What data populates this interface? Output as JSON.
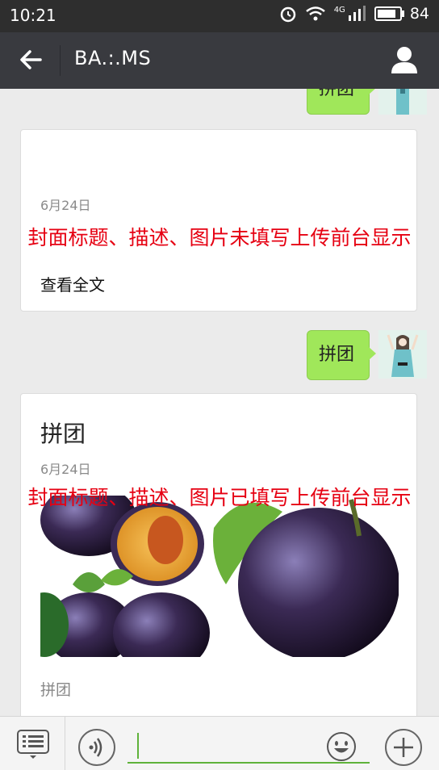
{
  "status": {
    "time": "10:21",
    "network": "4G",
    "battery": "84",
    "battery_level": 0.84
  },
  "header": {
    "title": "BA.:.MS"
  },
  "messages": [
    {
      "type": "sent",
      "text": "拼团"
    },
    {
      "type": "card",
      "date": "6月24日",
      "overlay": "封面标题、描述、图片未填写上传前台显示",
      "read_all": "查看全文"
    },
    {
      "type": "sent",
      "text": "拼团"
    },
    {
      "type": "card",
      "title": "拼团",
      "date": "6月24日",
      "overlay": "封面标题、描述、图片已填写上传前台显示",
      "desc": "拼团"
    }
  ],
  "colors": {
    "bubble": "#a0e75a",
    "overlay_text": "#e60012",
    "titlebar": "#393a3f"
  },
  "icons": [
    "back-arrow-icon",
    "profile-icon",
    "alarm-icon",
    "wifi-icon",
    "signal-icon",
    "menu-icon",
    "voice-icon",
    "emoji-icon",
    "plus-icon"
  ]
}
